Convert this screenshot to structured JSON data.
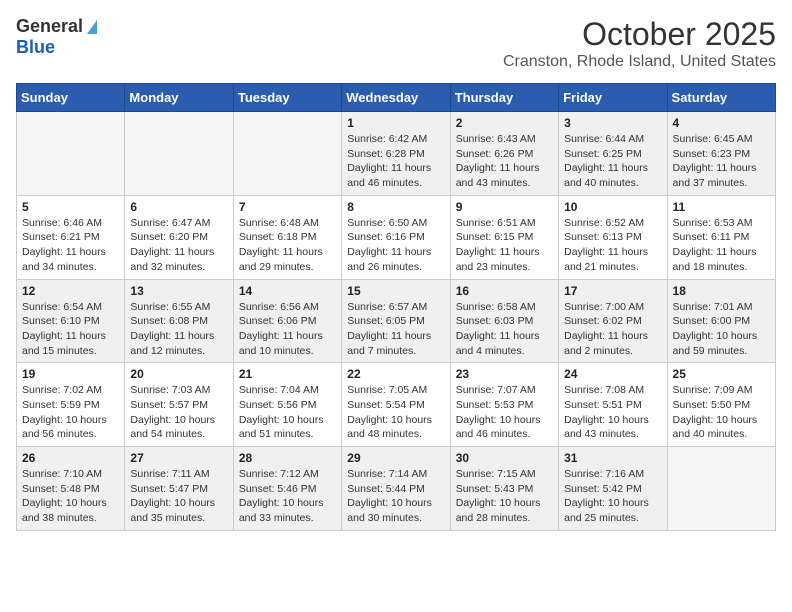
{
  "header": {
    "logo_general": "General",
    "logo_blue": "Blue",
    "month_title": "October 2025",
    "location": "Cranston, Rhode Island, United States"
  },
  "days_of_week": [
    "Sunday",
    "Monday",
    "Tuesday",
    "Wednesday",
    "Thursday",
    "Friday",
    "Saturday"
  ],
  "weeks": [
    [
      {
        "day": "",
        "empty": true
      },
      {
        "day": "",
        "empty": true
      },
      {
        "day": "",
        "empty": true
      },
      {
        "day": "1",
        "sunrise": "6:42 AM",
        "sunset": "6:28 PM",
        "daylight": "11 hours and 46 minutes."
      },
      {
        "day": "2",
        "sunrise": "6:43 AM",
        "sunset": "6:26 PM",
        "daylight": "11 hours and 43 minutes."
      },
      {
        "day": "3",
        "sunrise": "6:44 AM",
        "sunset": "6:25 PM",
        "daylight": "11 hours and 40 minutes."
      },
      {
        "day": "4",
        "sunrise": "6:45 AM",
        "sunset": "6:23 PM",
        "daylight": "11 hours and 37 minutes."
      }
    ],
    [
      {
        "day": "5",
        "sunrise": "6:46 AM",
        "sunset": "6:21 PM",
        "daylight": "11 hours and 34 minutes."
      },
      {
        "day": "6",
        "sunrise": "6:47 AM",
        "sunset": "6:20 PM",
        "daylight": "11 hours and 32 minutes."
      },
      {
        "day": "7",
        "sunrise": "6:48 AM",
        "sunset": "6:18 PM",
        "daylight": "11 hours and 29 minutes."
      },
      {
        "day": "8",
        "sunrise": "6:50 AM",
        "sunset": "6:16 PM",
        "daylight": "11 hours and 26 minutes."
      },
      {
        "day": "9",
        "sunrise": "6:51 AM",
        "sunset": "6:15 PM",
        "daylight": "11 hours and 23 minutes."
      },
      {
        "day": "10",
        "sunrise": "6:52 AM",
        "sunset": "6:13 PM",
        "daylight": "11 hours and 21 minutes."
      },
      {
        "day": "11",
        "sunrise": "6:53 AM",
        "sunset": "6:11 PM",
        "daylight": "11 hours and 18 minutes."
      }
    ],
    [
      {
        "day": "12",
        "sunrise": "6:54 AM",
        "sunset": "6:10 PM",
        "daylight": "11 hours and 15 minutes."
      },
      {
        "day": "13",
        "sunrise": "6:55 AM",
        "sunset": "6:08 PM",
        "daylight": "11 hours and 12 minutes."
      },
      {
        "day": "14",
        "sunrise": "6:56 AM",
        "sunset": "6:06 PM",
        "daylight": "11 hours and 10 minutes."
      },
      {
        "day": "15",
        "sunrise": "6:57 AM",
        "sunset": "6:05 PM",
        "daylight": "11 hours and 7 minutes."
      },
      {
        "day": "16",
        "sunrise": "6:58 AM",
        "sunset": "6:03 PM",
        "daylight": "11 hours and 4 minutes."
      },
      {
        "day": "17",
        "sunrise": "7:00 AM",
        "sunset": "6:02 PM",
        "daylight": "11 hours and 2 minutes."
      },
      {
        "day": "18",
        "sunrise": "7:01 AM",
        "sunset": "6:00 PM",
        "daylight": "10 hours and 59 minutes."
      }
    ],
    [
      {
        "day": "19",
        "sunrise": "7:02 AM",
        "sunset": "5:59 PM",
        "daylight": "10 hours and 56 minutes."
      },
      {
        "day": "20",
        "sunrise": "7:03 AM",
        "sunset": "5:57 PM",
        "daylight": "10 hours and 54 minutes."
      },
      {
        "day": "21",
        "sunrise": "7:04 AM",
        "sunset": "5:56 PM",
        "daylight": "10 hours and 51 minutes."
      },
      {
        "day": "22",
        "sunrise": "7:05 AM",
        "sunset": "5:54 PM",
        "daylight": "10 hours and 48 minutes."
      },
      {
        "day": "23",
        "sunrise": "7:07 AM",
        "sunset": "5:53 PM",
        "daylight": "10 hours and 46 minutes."
      },
      {
        "day": "24",
        "sunrise": "7:08 AM",
        "sunset": "5:51 PM",
        "daylight": "10 hours and 43 minutes."
      },
      {
        "day": "25",
        "sunrise": "7:09 AM",
        "sunset": "5:50 PM",
        "daylight": "10 hours and 40 minutes."
      }
    ],
    [
      {
        "day": "26",
        "sunrise": "7:10 AM",
        "sunset": "5:48 PM",
        "daylight": "10 hours and 38 minutes."
      },
      {
        "day": "27",
        "sunrise": "7:11 AM",
        "sunset": "5:47 PM",
        "daylight": "10 hours and 35 minutes."
      },
      {
        "day": "28",
        "sunrise": "7:12 AM",
        "sunset": "5:46 PM",
        "daylight": "10 hours and 33 minutes."
      },
      {
        "day": "29",
        "sunrise": "7:14 AM",
        "sunset": "5:44 PM",
        "daylight": "10 hours and 30 minutes."
      },
      {
        "day": "30",
        "sunrise": "7:15 AM",
        "sunset": "5:43 PM",
        "daylight": "10 hours and 28 minutes."
      },
      {
        "day": "31",
        "sunrise": "7:16 AM",
        "sunset": "5:42 PM",
        "daylight": "10 hours and 25 minutes."
      },
      {
        "day": "",
        "empty": true
      }
    ]
  ],
  "labels": {
    "sunrise": "Sunrise:",
    "sunset": "Sunset:",
    "daylight": "Daylight:"
  }
}
